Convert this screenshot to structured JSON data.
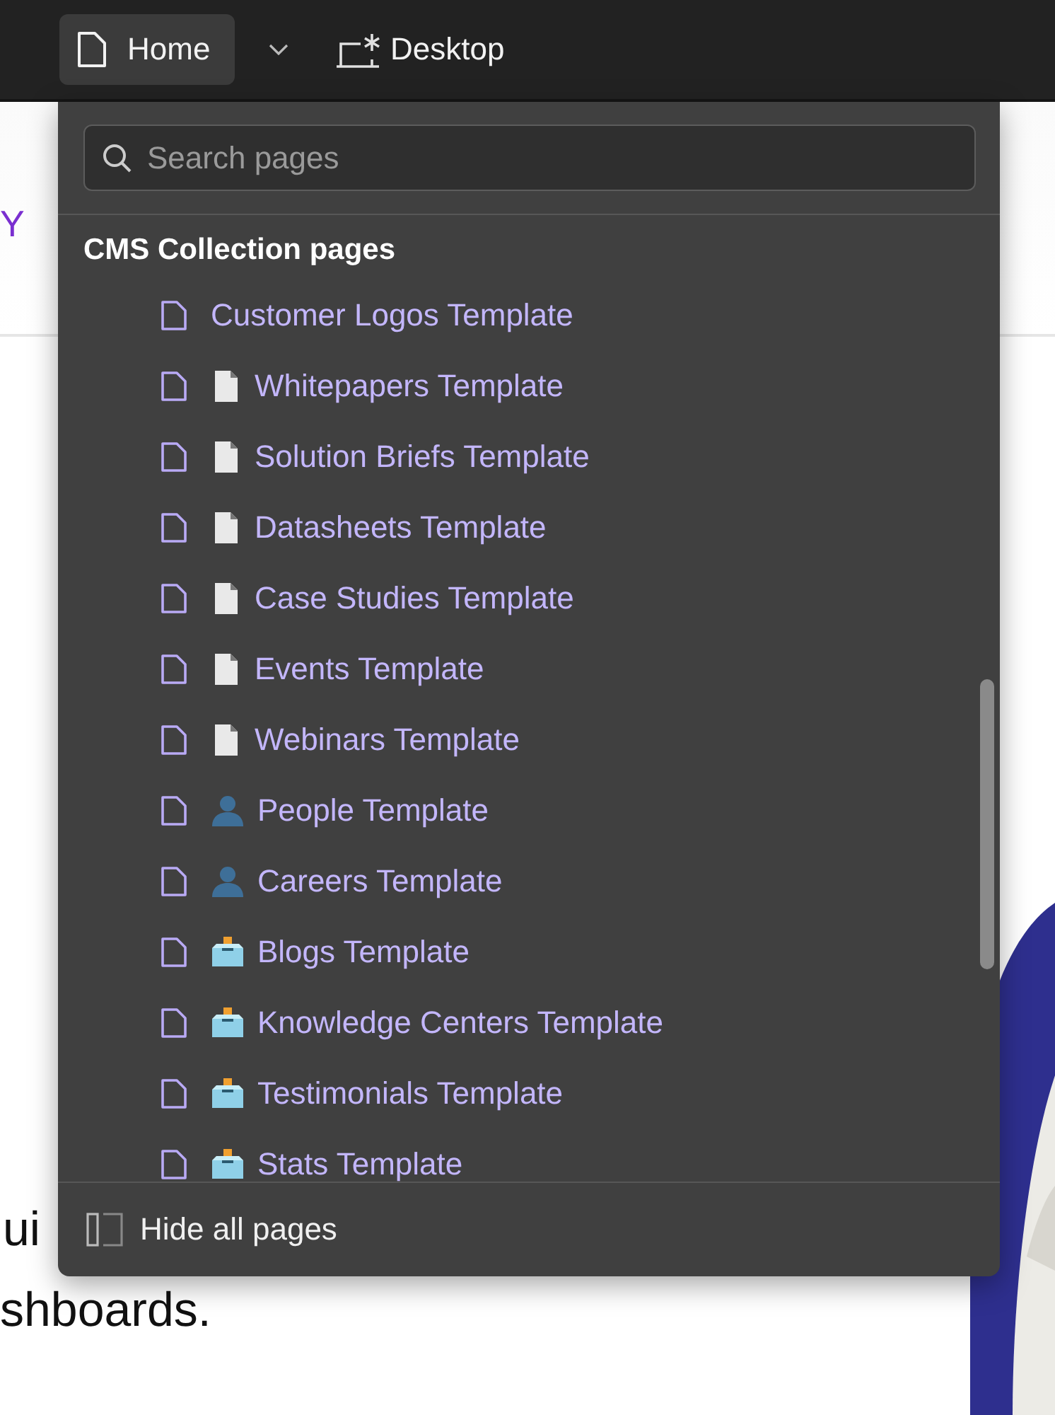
{
  "topbar": {
    "page_button": {
      "label": "Home"
    },
    "breakpoint": {
      "label": "Desktop"
    }
  },
  "background_page": {
    "nav_text": "Y",
    "body_lines": [
      "ui",
      "shboards."
    ]
  },
  "dropdown": {
    "search": {
      "placeholder": "Search pages"
    },
    "section_title": "CMS Collection pages",
    "items": [
      {
        "label": "Customer Logos Template",
        "kind": "plain"
      },
      {
        "label": "Whitepapers Template",
        "kind": "document"
      },
      {
        "label": "Solution Briefs Template",
        "kind": "document"
      },
      {
        "label": "Datasheets Template",
        "kind": "document"
      },
      {
        "label": "Case Studies Template",
        "kind": "document"
      },
      {
        "label": "Events Template",
        "kind": "document"
      },
      {
        "label": "Webinars Template",
        "kind": "document"
      },
      {
        "label": "People Template",
        "kind": "person"
      },
      {
        "label": "Careers Template",
        "kind": "person"
      },
      {
        "label": "Blogs Template",
        "kind": "ballot"
      },
      {
        "label": "Knowledge Centers Template",
        "kind": "ballot"
      },
      {
        "label": "Testimonials Template",
        "kind": "ballot"
      },
      {
        "label": "Stats Template",
        "kind": "ballot"
      }
    ],
    "footer": {
      "label": "Hide all pages"
    }
  }
}
